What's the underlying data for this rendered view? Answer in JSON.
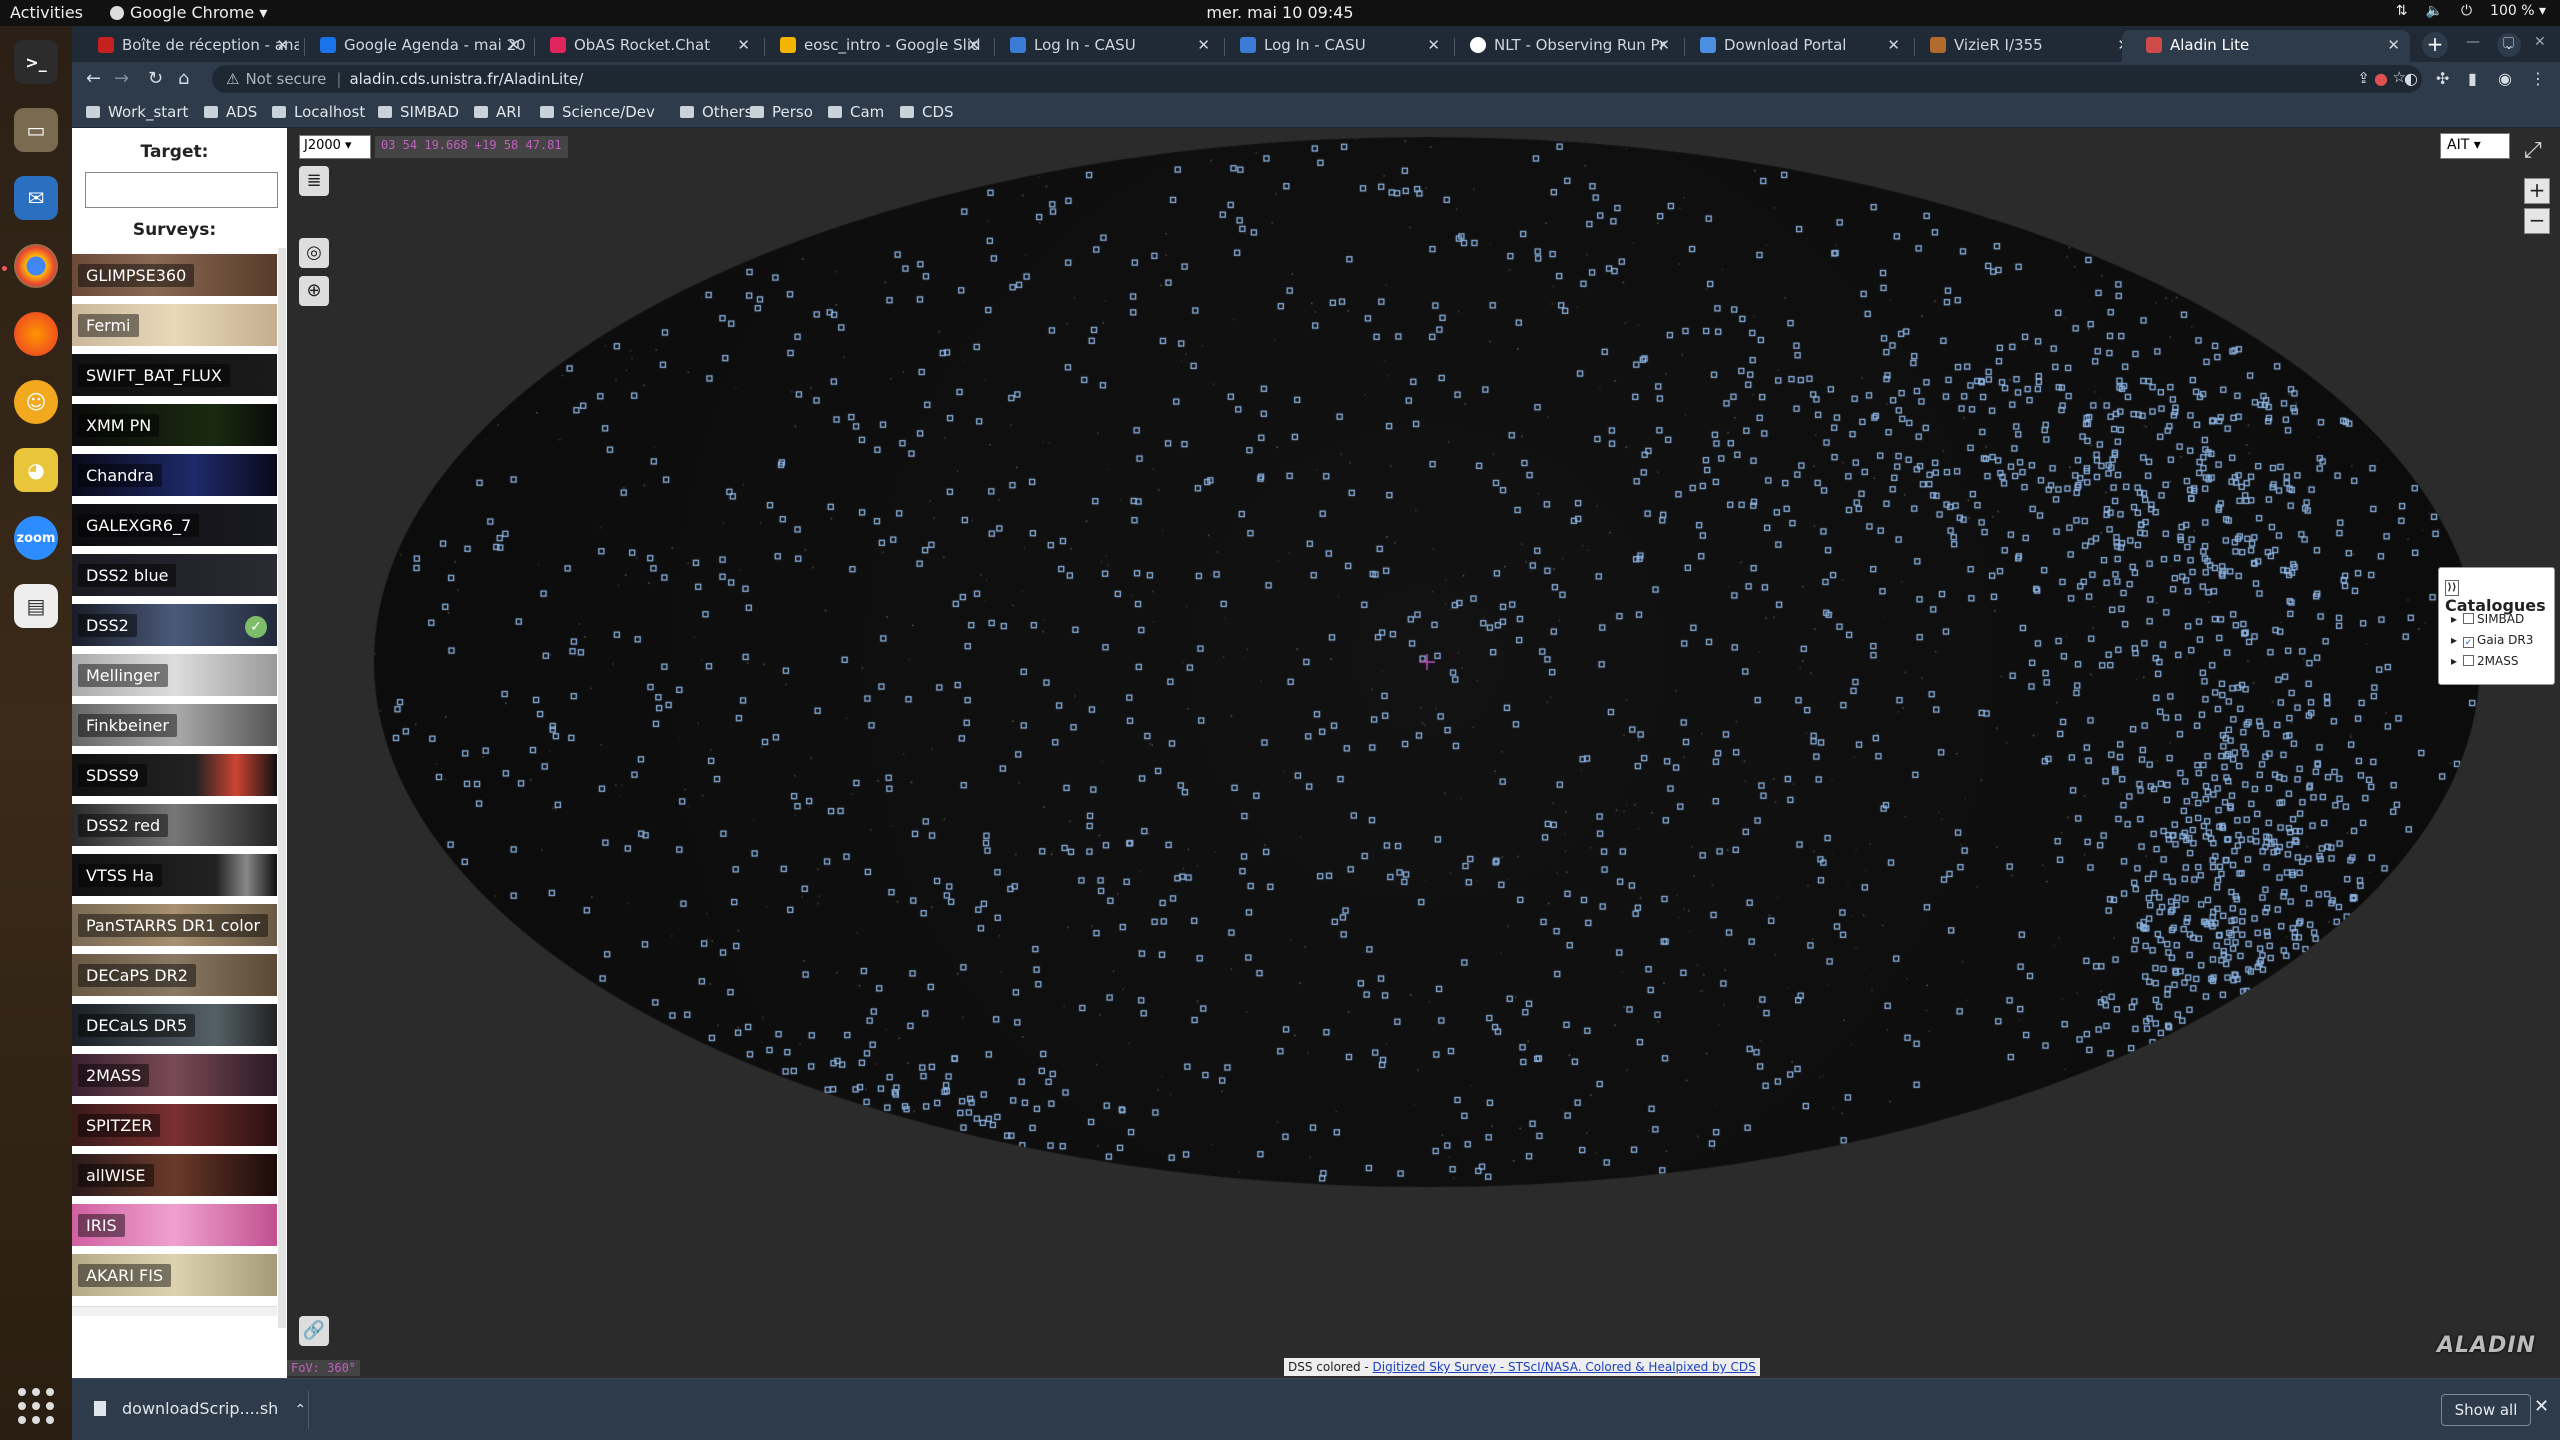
{
  "system": {
    "activities": "Activities",
    "app_name": "Google Chrome ▾",
    "clock": "mer. mai 10  09:45",
    "battery": "100 % ▾"
  },
  "tabs": [
    {
      "label": "Boîte de réception - ana",
      "color": "#c5221f"
    },
    {
      "label": "Google Agenda - mai 20",
      "color": "#1a73e8"
    },
    {
      "label": "ObAS Rocket.Chat",
      "color": "#e0245e"
    },
    {
      "label": "eosc_intro - Google Slid",
      "color": "#f4b400"
    },
    {
      "label": "Log In - CASU",
      "color": "#3a7bd5"
    },
    {
      "label": "Log In - CASU",
      "color": "#3a7bd5"
    },
    {
      "label": "NLT - Observing Run Pr",
      "color": "#ffffff"
    },
    {
      "label": "Download Portal",
      "color": "#4a8fe0"
    },
    {
      "label": "VizieR I/355",
      "color": "#b36b2d"
    },
    {
      "label": "Aladin Lite",
      "color": "#d04a4a"
    }
  ],
  "omnibox": {
    "not_secure": "Not secure",
    "url": "aladin.cds.unistra.fr/AladinLite/"
  },
  "bookmarks": [
    "Work_start",
    "ADS",
    "Localhost",
    "SIMBAD",
    "ARI",
    "Science/Dev",
    "Others",
    "Perso",
    "Cam",
    "CDS"
  ],
  "left_panel": {
    "target_label": "Target:",
    "target_value": "",
    "surveys_label": "Surveys:",
    "surveys": [
      {
        "name": "GLIMPSE360",
        "bg": "linear-gradient(90deg,#6b4a3a,#8a6a55 40%,#5a3a2a)"
      },
      {
        "name": "Fermi",
        "bg": "linear-gradient(90deg,#cbb89c,#e8d8b8 50%,#c4ae8e)"
      },
      {
        "name": "SWIFT_BAT_FLUX",
        "bg": "linear-gradient(90deg,#111,#1a1a1a)"
      },
      {
        "name": "XMM PN",
        "bg": "linear-gradient(90deg,#0b0b0b,#1a2a10 70%,#0a0a0a)"
      },
      {
        "name": "Chandra",
        "bg": "linear-gradient(90deg,#0a0a1a,#1e2a6a 60%,#0a0a1a)"
      },
      {
        "name": "GALEXGR6_7",
        "bg": "linear-gradient(90deg,#0d0d10,#1a1a22)"
      },
      {
        "name": "DSS2 blue",
        "bg": "linear-gradient(90deg,#1b1b22,#2a2a33)"
      },
      {
        "name": "DSS2",
        "bg": "linear-gradient(90deg,#1a1d28,#4a5a7a 50%,#222a3a)",
        "selected": true
      },
      {
        "name": "Mellinger",
        "bg": "linear-gradient(90deg,#aaa,#ddd 50%,#999)"
      },
      {
        "name": "Finkbeiner",
        "bg": "linear-gradient(90deg,#666,#aaa 50%,#555)"
      },
      {
        "name": "SDSS9",
        "bg": "linear-gradient(90deg,#111,#222 60%,#c43 80%,#111)"
      },
      {
        "name": "DSS2 red",
        "bg": "linear-gradient(90deg,#2a2a2a,#777 50%,#222)"
      },
      {
        "name": "VTSS Ha",
        "bg": "linear-gradient(90deg,#111,#222 70%,#888 85%,#111)"
      },
      {
        "name": "PanSTARRS DR1 color",
        "bg": "linear-gradient(90deg,#7a6a55,#a89070 50%,#6a5a45)"
      },
      {
        "name": "DECaPS DR2",
        "bg": "linear-gradient(90deg,#6a5a45,#8a7a65 50%,#5a4a35)"
      },
      {
        "name": "DECaLS DR5",
        "bg": "linear-gradient(90deg,#1a2025,#556066 70%,#222)"
      },
      {
        "name": "2MASS",
        "bg": "linear-gradient(90deg,#3a2030,#7a4a55 50%,#2a1a25)"
      },
      {
        "name": "SPITZER",
        "bg": "linear-gradient(90deg,#3a1a1a,#7a3030 50%,#2a1010)"
      },
      {
        "name": "allWISE",
        "bg": "linear-gradient(90deg,#2a1a1a,#6a3a2a 50%,#1a0a0a)"
      },
      {
        "name": "IRIS",
        "bg": "linear-gradient(90deg,#d060a0,#f0a0d0 50%,#c05090)"
      },
      {
        "name": "AKARI FIS",
        "bg": "linear-gradient(90deg,#b5aa88,#ddd2b0 50%,#a59a78)"
      }
    ]
  },
  "view": {
    "frame": "J2000",
    "coords": "03 54 19.668 +19 58 47.81",
    "projection": "AIT",
    "fov": "FoV: 360°",
    "credit_prefix": "DSS colored - ",
    "credit_link": "Digitized Sky Survey - STScI/NASA. Colored & Healpixed by CDS",
    "logo": "ALADIN",
    "marker_color": "#8fb8e8"
  },
  "catalogues": {
    "title": "Catalogues",
    "items": [
      {
        "name": "SIMBAD",
        "checked": false
      },
      {
        "name": "Gaia DR3",
        "checked": true
      },
      {
        "name": "2MASS",
        "checked": false
      }
    ]
  },
  "downloads": {
    "file": "downloadScrip....sh",
    "show_all": "Show all"
  }
}
